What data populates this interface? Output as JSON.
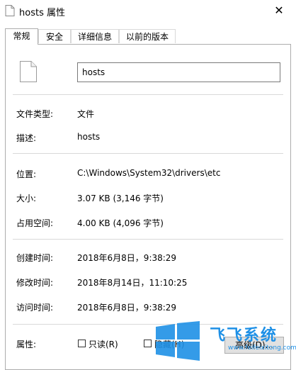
{
  "window": {
    "title": "hosts 属性",
    "close_glyph": "✕"
  },
  "tabs": [
    {
      "label": "常规",
      "active": true
    },
    {
      "label": "安全",
      "active": false
    },
    {
      "label": "详细信息",
      "active": false
    },
    {
      "label": "以前的版本",
      "active": false
    }
  ],
  "general": {
    "filename": "hosts",
    "rows": [
      {
        "label": "文件类型:",
        "value": "文件"
      },
      {
        "label": "描述:",
        "value": "hosts"
      },
      {
        "label": "位置:",
        "value": "C:\\Windows\\System32\\drivers\\etc"
      },
      {
        "label": "大小:",
        "value": "3.07 KB (3,146 字节)"
      },
      {
        "label": "占用空间:",
        "value": "4.00 KB (4,096 字节)"
      },
      {
        "label": "创建时间:",
        "value": "2018年6月8日，9:38:29"
      },
      {
        "label": "修改时间:",
        "value": "2018年8月14日，11:10:25"
      },
      {
        "label": "访问时间:",
        "value": "2018年6月8日，9:38:29"
      }
    ],
    "attributes": {
      "label": "属性:",
      "readonly_label": "只读(R)",
      "hidden_label": "隐藏(H)",
      "advanced_label": "高级(D)..."
    }
  },
  "watermark": {
    "title": "飞飞系统",
    "url": "www.feifeixitong.com"
  },
  "colors": {
    "accent": "#1e90e6",
    "border": "#adadad"
  }
}
